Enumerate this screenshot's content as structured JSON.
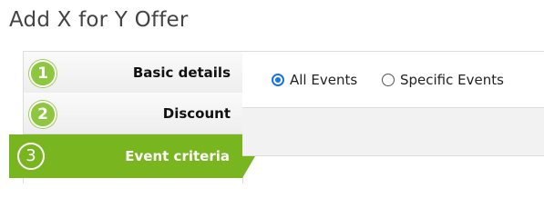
{
  "page": {
    "title": "Add X for Y Offer"
  },
  "steps": [
    {
      "number": "1",
      "label": "Basic details"
    },
    {
      "number": "2",
      "label": "Discount"
    },
    {
      "number": "3",
      "label": "Event criteria"
    }
  ],
  "event_scope": {
    "selected": "All Events",
    "options": [
      {
        "label": "All Events"
      },
      {
        "label": "Specific Events"
      }
    ]
  },
  "colors": {
    "active_step": "#79b51f",
    "step_badge": "#8ec63f",
    "radio_accent": "#1a73e8"
  }
}
